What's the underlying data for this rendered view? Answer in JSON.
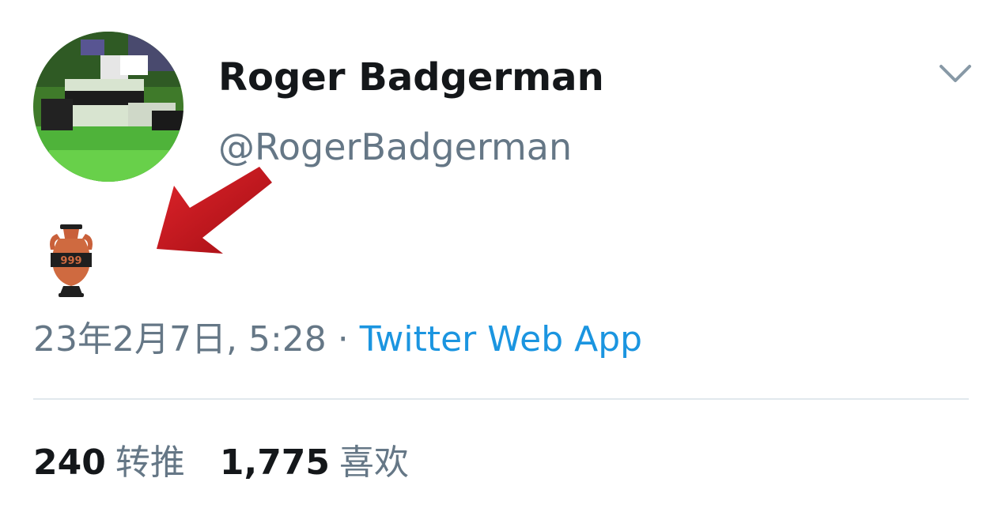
{
  "tweet": {
    "author": {
      "display_name": "Roger Badgerman",
      "handle": "@RogerBadgerman",
      "avatar_icon": "badger-avatar"
    },
    "menu_icon": "chevron-down-icon",
    "content_icon": "amphora-emoji",
    "annotation": "red-arrow-icon",
    "meta": {
      "timestamp": "23年2月7日, 5:28",
      "separator": "·",
      "source": "Twitter Web App"
    },
    "stats": [
      {
        "count": "240",
        "label": "转推"
      },
      {
        "count": "1,775",
        "label": "喜欢"
      }
    ]
  },
  "colors": {
    "text_primary": "#14171a",
    "text_secondary": "#657786",
    "link": "#1b95e0",
    "divider": "#e1e8ed",
    "arrow": "#c8161d"
  }
}
